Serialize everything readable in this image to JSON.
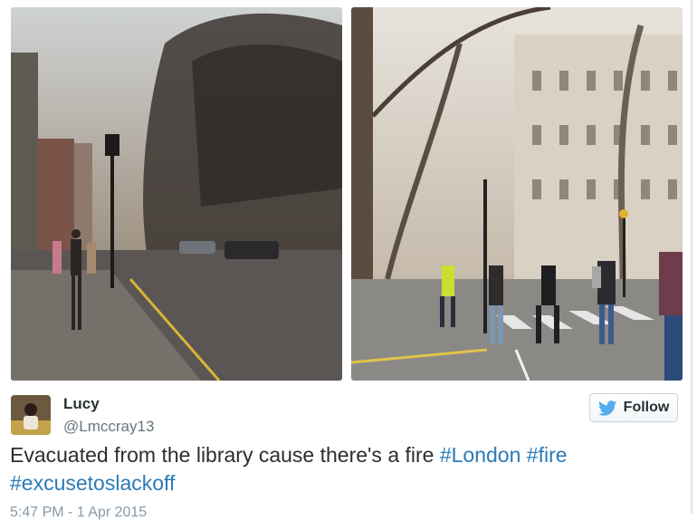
{
  "tweet": {
    "author_name": "Lucy",
    "author_handle": "@Lmccray13",
    "follow_label": "Follow",
    "text_parts": [
      {
        "text": "Evacuated from the library cause there's a fire ",
        "type": "text"
      },
      {
        "text": "#London",
        "type": "hashtag"
      },
      {
        "text": " ",
        "type": "text"
      },
      {
        "text": "#fire",
        "type": "hashtag"
      },
      {
        "text": " ",
        "type": "text"
      },
      {
        "text": "#excusetoslackoff",
        "type": "hashtag"
      }
    ],
    "timestamp": "5:47 PM - 1 Apr 2015"
  },
  "icons": {
    "follow_icon": "twitter-bird-icon"
  },
  "colors": {
    "hashtag": "#2b7bb9",
    "text": "#292f33",
    "handle": "#66757f",
    "twitter_blue": "#55acee"
  }
}
